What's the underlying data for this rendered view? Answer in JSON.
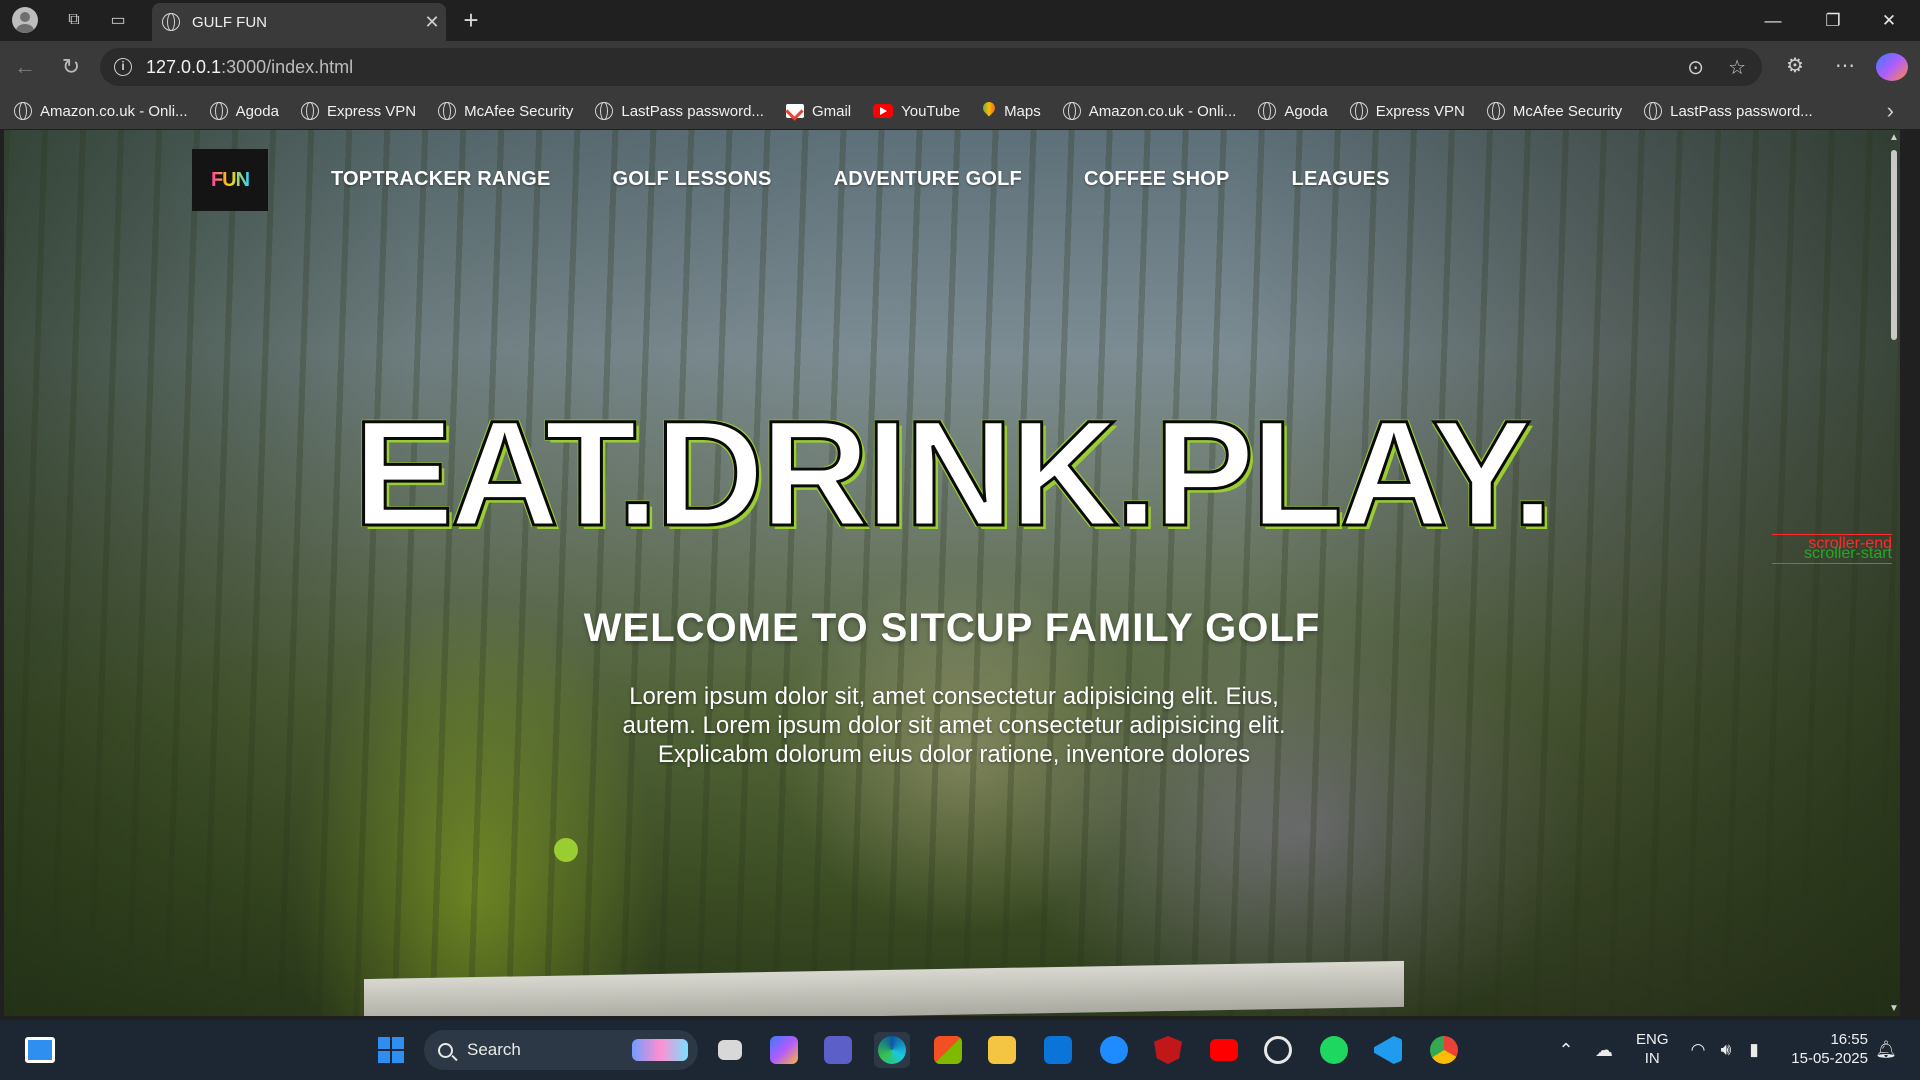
{
  "browser": {
    "tab_title": "GULF FUN",
    "url_host": "127.0.0.1",
    "url_path": ":3000/index.html",
    "bookmarks": [
      {
        "label": "Amazon.co.uk - Onli...",
        "icon": "globe-icon"
      },
      {
        "label": "Agoda",
        "icon": "globe-icon"
      },
      {
        "label": "Express VPN",
        "icon": "globe-icon"
      },
      {
        "label": "McAfee Security",
        "icon": "globe-icon"
      },
      {
        "label": "LastPass password...",
        "icon": "globe-icon"
      },
      {
        "label": "Gmail",
        "icon": "gmail-icon"
      },
      {
        "label": "YouTube",
        "icon": "youtube-icon"
      },
      {
        "label": "Maps",
        "icon": "maps-icon"
      },
      {
        "label": "Amazon.co.uk - Onli...",
        "icon": "globe-icon"
      },
      {
        "label": "Agoda",
        "icon": "globe-icon"
      },
      {
        "label": "Express VPN",
        "icon": "globe-icon"
      },
      {
        "label": "McAfee Security",
        "icon": "globe-icon"
      },
      {
        "label": "LastPass password...",
        "icon": "globe-icon"
      }
    ]
  },
  "page": {
    "logo_text": "FUN",
    "nav": [
      "TOPTRACKER RANGE",
      "GOLF LESSONS",
      "ADVENTURE GOLF",
      "COFFEE SHOP",
      "LEAGUES"
    ],
    "headline": "EAT.DRINK.PLAY.",
    "welcome": "WELCOME TO SITCUP FAMILY GOLF",
    "lorem_lines": [
      "Lorem ipsum dolor sit, amet consectetur adipisicing elit. Eius,",
      "autem. Lorem ipsum dolor sit amet consectetur adipisicing elit.",
      "Explicabm dolorum eius dolor ratione, inventore dolores"
    ],
    "scroller_end": "scroller-end",
    "scroller_start": "scroller-start",
    "accent_color": "#9acd32"
  },
  "taskbar": {
    "search_placeholder": "Search",
    "lang_line1": "ENG",
    "lang_line2": "IN",
    "time": "16:55",
    "date": "15-05-2025"
  }
}
